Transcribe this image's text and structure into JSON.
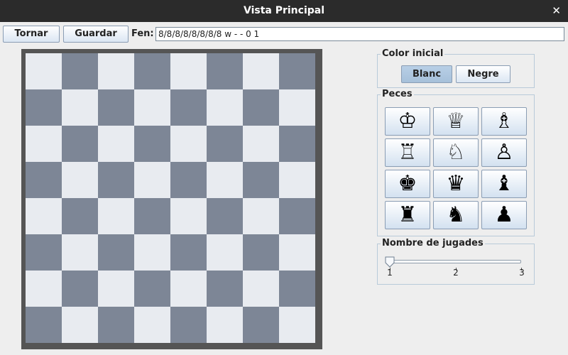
{
  "window": {
    "title": "Vista Principal"
  },
  "toolbar": {
    "back_label": "Tornar",
    "save_label": "Guardar",
    "fen_label": "Fen:",
    "fen_value": "8/8/8/8/8/8/8/8 w - - 0 1"
  },
  "colors": {
    "light_square": "#e8ebf0",
    "dark_square": "#7d8696",
    "board_frame": "#555555",
    "selected_button": "#b3cbe3"
  },
  "color_group": {
    "title": "Color inicial",
    "options": [
      "Blanc",
      "Negre"
    ],
    "selected": "Blanc"
  },
  "pieces_group": {
    "title": "Peces",
    "pieces": [
      {
        "name": "white-king",
        "glyph": "♔"
      },
      {
        "name": "white-queen",
        "glyph": "♕"
      },
      {
        "name": "white-bishop",
        "glyph": "♗"
      },
      {
        "name": "white-rook",
        "glyph": "♖"
      },
      {
        "name": "white-knight",
        "glyph": "♘"
      },
      {
        "name": "white-pawn",
        "glyph": "♙"
      },
      {
        "name": "black-king",
        "glyph": "♚"
      },
      {
        "name": "black-queen",
        "glyph": "♛"
      },
      {
        "name": "black-bishop",
        "glyph": "♝"
      },
      {
        "name": "black-rook",
        "glyph": "♜"
      },
      {
        "name": "black-knight",
        "glyph": "♞"
      },
      {
        "name": "black-pawn",
        "glyph": "♟"
      }
    ]
  },
  "moves_group": {
    "title": "Nombre de jugades",
    "min": 1,
    "max": 3,
    "value": 1,
    "tick_labels": [
      "1",
      "2",
      "3"
    ]
  },
  "board": {
    "files": 8,
    "ranks": 8,
    "empty": true
  }
}
